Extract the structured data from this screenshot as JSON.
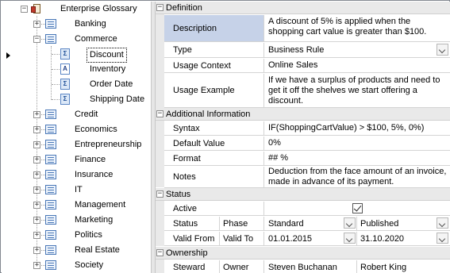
{
  "tree": {
    "root": "Enterprise Glossary",
    "items": [
      {
        "label": "Banking",
        "expanded": false
      },
      {
        "label": "Commerce",
        "expanded": true
      },
      {
        "label": "Credit",
        "expanded": false
      },
      {
        "label": "Economics",
        "expanded": false
      },
      {
        "label": "Entrepreneurship",
        "expanded": false
      },
      {
        "label": "Finance",
        "expanded": false
      },
      {
        "label": "Insurance",
        "expanded": false
      },
      {
        "label": "IT",
        "expanded": false
      },
      {
        "label": "Management",
        "expanded": false
      },
      {
        "label": "Marketing",
        "expanded": false
      },
      {
        "label": "Politics",
        "expanded": false
      },
      {
        "label": "Real Estate",
        "expanded": false
      },
      {
        "label": "Society",
        "expanded": false
      }
    ],
    "commerce_children": [
      {
        "label": "Discount",
        "icon": "business-rule-icon"
      },
      {
        "label": "Inventory",
        "icon": "attribute-icon"
      },
      {
        "label": "Order Date",
        "icon": "business-rule-icon"
      },
      {
        "label": "Shipping Date",
        "icon": "business-rule-icon"
      }
    ],
    "expander_expanded": "−",
    "expander_collapsed": "+",
    "attribute_glyph": "A",
    "rule_glyph": "Σ"
  },
  "definition": {
    "title": "Definition",
    "description_label": "Description",
    "description_value": "A discount of 5% is applied when the shopping cart value is greater than $100.",
    "type_label": "Type",
    "type_value": "Business Rule",
    "usage_context_label": "Usage Context",
    "usage_context_value": "Online Sales",
    "usage_example_label": "Usage Example",
    "usage_example_value": "If we have a surplus of products and need to get it off the shelves we start offering a discount."
  },
  "additional": {
    "title": "Additional Information",
    "syntax_label": "Syntax",
    "syntax_value": "IF(ShoppingCartValue) > $100, 5%, 0%)",
    "default_label": "Default Value",
    "default_value": "0%",
    "format_label": "Format",
    "format_value": "## %",
    "notes_label": "Notes",
    "notes_value": "Deduction from the face amount of an invoice, made in advance of its payment."
  },
  "status": {
    "title": "Status",
    "active_label": "Active",
    "active_checked": true,
    "status_label": "Status",
    "phase_label": "Phase",
    "phase_value": "Standard",
    "publish_value": "Published",
    "valid_from_label": "Valid From",
    "valid_to_label": "Valid To",
    "valid_from_value": "01.01.2015",
    "valid_to_value": "31.10.2020"
  },
  "ownership": {
    "title": "Ownership",
    "steward_label": "Steward",
    "owner_label": "Owner",
    "steward_value": "Steven Buchanan",
    "owner_value": "Robert King"
  },
  "colors": {
    "selected_row": "#c6d2e8",
    "category_bg": "#e9e9e9",
    "grid_line": "#d4d4d4"
  }
}
